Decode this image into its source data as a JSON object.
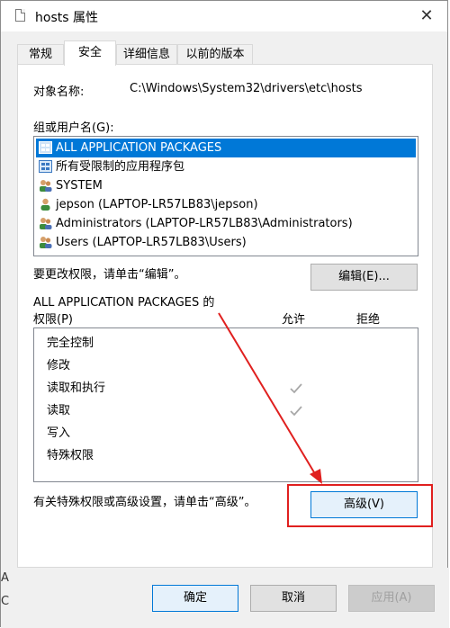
{
  "window": {
    "title": "hosts 属性",
    "close_glyph": "✕"
  },
  "tabs": [
    {
      "label": "常规",
      "active": false
    },
    {
      "label": "安全",
      "active": true
    },
    {
      "label": "详细信息",
      "active": false
    },
    {
      "label": "以前的版本",
      "active": false
    }
  ],
  "object": {
    "label": "对象名称:",
    "value": "C:\\Windows\\System32\\drivers\\etc\\hosts"
  },
  "groups": {
    "label": "组或用户名(G):",
    "items": [
      {
        "name": "ALL APPLICATION PACKAGES",
        "icon": "app-package-icon",
        "selected": true
      },
      {
        "name": "所有受限制的应用程序包",
        "icon": "app-package-icon",
        "selected": false
      },
      {
        "name": "SYSTEM",
        "icon": "group-users-icon",
        "selected": false
      },
      {
        "name": "jepson (LAPTOP-LR57LB83\\jepson)",
        "icon": "user-icon",
        "selected": false
      },
      {
        "name": "Administrators (LAPTOP-LR57LB83\\Administrators)",
        "icon": "group-users-icon",
        "selected": false
      },
      {
        "name": "Users (LAPTOP-LR57LB83\\Users)",
        "icon": "group-users-icon",
        "selected": false
      }
    ]
  },
  "edit": {
    "hint": "要更改权限，请单击“编辑”。",
    "button": "编辑(E)..."
  },
  "permissions": {
    "title_line1": "ALL APPLICATION PACKAGES 的",
    "title_line2": "权限(P)",
    "allow_header": "允许",
    "deny_header": "拒绝",
    "rows": [
      {
        "name": "完全控制",
        "allow": false,
        "deny": false
      },
      {
        "name": "修改",
        "allow": false,
        "deny": false
      },
      {
        "name": "读取和执行",
        "allow": true,
        "deny": false
      },
      {
        "name": "读取",
        "allow": true,
        "deny": false
      },
      {
        "name": "写入",
        "allow": false,
        "deny": false
      },
      {
        "name": "特殊权限",
        "allow": false,
        "deny": false
      }
    ]
  },
  "advanced": {
    "hint": "有关特殊权限或高级设置，请单击“高级”。",
    "button": "高级(V)"
  },
  "footer": {
    "ok": "确定",
    "cancel": "取消",
    "apply": "应用(A)"
  },
  "edge": {
    "glyph1": "A",
    "glyph2": "C"
  },
  "colors": {
    "selection": "#0078d7",
    "annotation": "#e0201f"
  }
}
